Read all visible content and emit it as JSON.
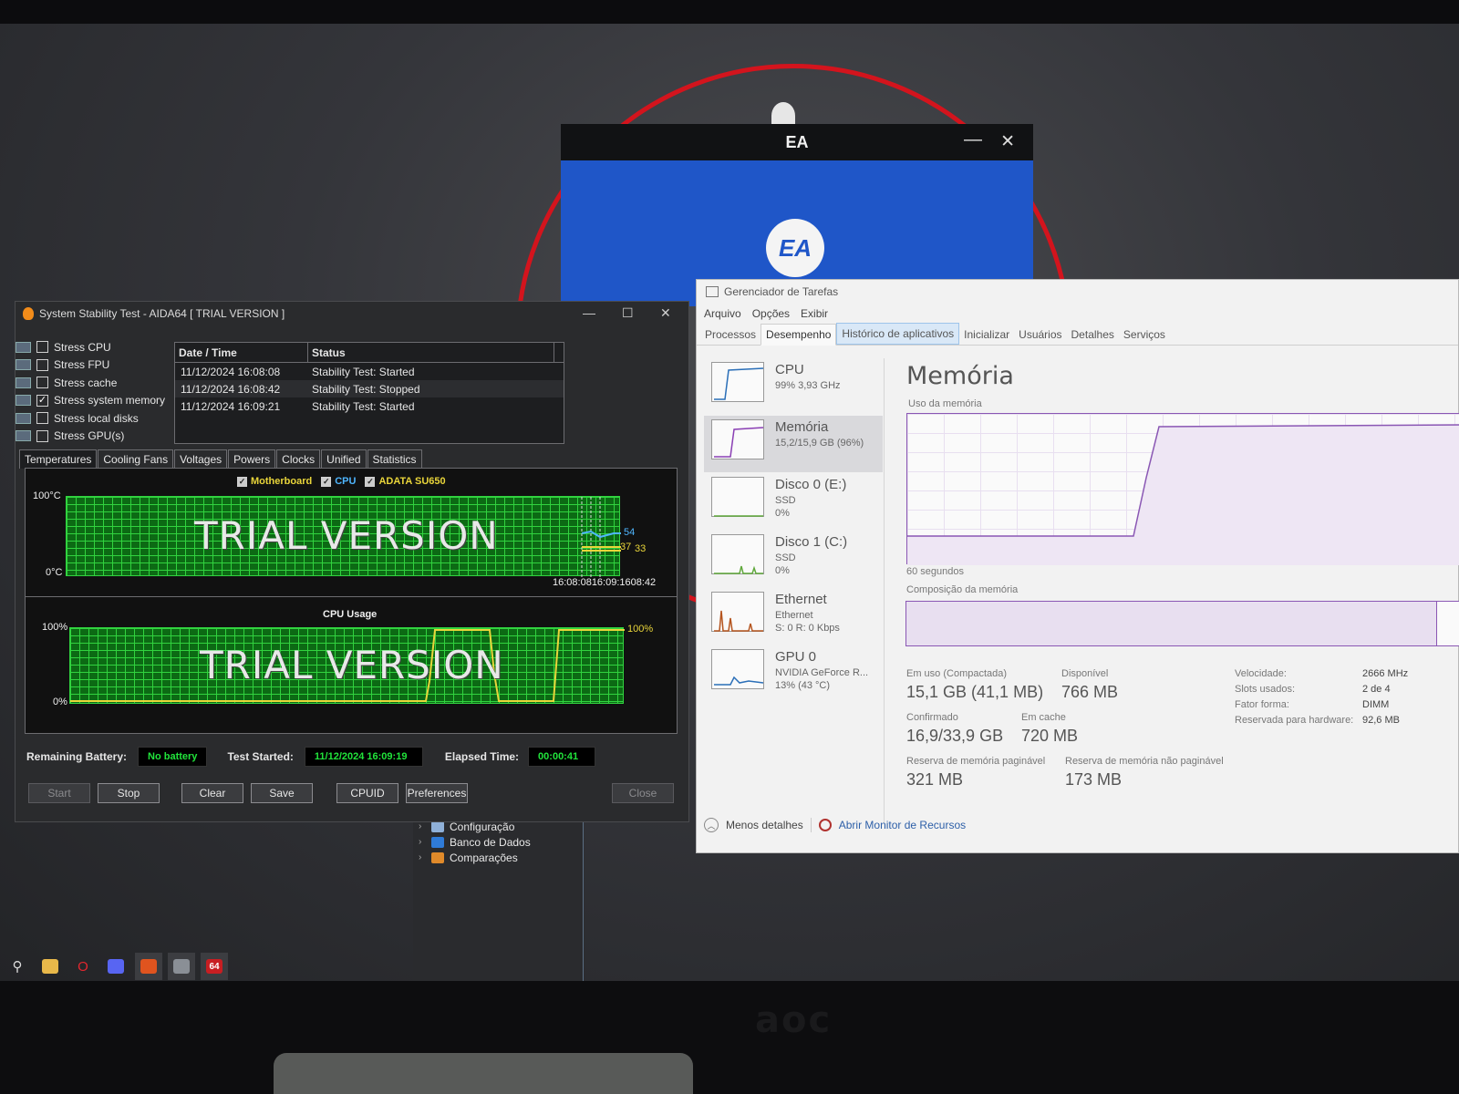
{
  "ea": {
    "title": "EA",
    "logo": "EA",
    "min_icon": "—",
    "close_icon": "✕"
  },
  "tree": {
    "items": [
      {
        "label": "Configuração",
        "color": "#8fb0d8"
      },
      {
        "label": "Banco de Dados",
        "color": "#2f7bd8"
      },
      {
        "label": "Comparações",
        "color": "#e08a2a"
      }
    ]
  },
  "taskbar": {
    "items": [
      {
        "icon": "search-icon",
        "glyph": "⚲",
        "color": ""
      },
      {
        "icon": "folder-icon",
        "glyph": "",
        "color": "#e8b84a"
      },
      {
        "icon": "opera-icon",
        "glyph": "O",
        "color": ""
      },
      {
        "icon": "discord-icon",
        "glyph": "",
        "color": "#5865f2"
      },
      {
        "icon": "ea-app-icon",
        "glyph": "",
        "color": "#e0541f"
      },
      {
        "icon": "task-manager-icon",
        "glyph": "",
        "color": "#8a8f96"
      },
      {
        "icon": "aida64-icon",
        "glyph": "64",
        "color": "#c81e22"
      }
    ]
  },
  "aida": {
    "title": "System Stability Test - AIDA64  [ TRIAL VERSION ]",
    "stress": [
      {
        "label": "Stress CPU",
        "checked": false
      },
      {
        "label": "Stress FPU",
        "checked": false
      },
      {
        "label": "Stress cache",
        "checked": false
      },
      {
        "label": "Stress system memory",
        "checked": true
      },
      {
        "label": "Stress local disks",
        "checked": false
      },
      {
        "label": "Stress GPU(s)",
        "checked": false
      }
    ],
    "log_headers": [
      "Date / Time",
      "Status"
    ],
    "log": [
      {
        "time": "11/12/2024 16:08:08",
        "status": "Stability Test: Started"
      },
      {
        "time": "11/12/2024 16:08:42",
        "status": "Stability Test: Stopped"
      },
      {
        "time": "11/12/2024 16:09:21",
        "status": "Stability Test: Started"
      }
    ],
    "tabs": [
      "Temperatures",
      "Cooling Fans",
      "Voltages",
      "Powers",
      "Clocks",
      "Unified",
      "Statistics"
    ],
    "active_tab": 0,
    "temp_legend": [
      {
        "label": "Motherboard",
        "color": "#e9d53a"
      },
      {
        "label": "CPU",
        "color": "#4fb6ff"
      },
      {
        "label": "ADATA SU650",
        "color": "#e9d53a"
      }
    ],
    "temp_max": "100°C",
    "temp_min": "0°C",
    "temp_time": "16:08:0816:09:1608:42",
    "temp_values": [
      "54",
      "37",
      "33"
    ],
    "watermark": "TRIAL VERSION",
    "cpu_title": "CPU Usage",
    "cpu_max": "100%",
    "cpu_min": "0%",
    "cpu_value": "100%",
    "battery_label": "Remaining Battery:",
    "battery_value": "No battery",
    "test_started_label": "Test Started:",
    "test_started_value": "11/12/2024 16:09:19",
    "elapsed_label": "Elapsed Time:",
    "elapsed_value": "00:00:41",
    "buttons": {
      "start": "Start",
      "stop": "Stop",
      "clear": "Clear",
      "save": "Save",
      "cpuid": "CPUID",
      "preferences": "Preferences",
      "close": "Close"
    }
  },
  "tm": {
    "title": "Gerenciador de Tarefas",
    "menu": [
      "Arquivo",
      "Opções",
      "Exibir"
    ],
    "tabs": [
      "Processos",
      "Desempenho",
      "Histórico de aplicativos",
      "Inicializar",
      "Usuários",
      "Detalhes",
      "Serviços"
    ],
    "active_tab": 1,
    "hover_tab": 2,
    "side": [
      {
        "name": "CPU",
        "l1": "99%  3,93 GHz",
        "l2": "",
        "color": "#2b6fb8"
      },
      {
        "name": "Memória",
        "l1": "15,2/15,9 GB (96%)",
        "l2": "",
        "color": "#8a3fb4"
      },
      {
        "name": "Disco 0 (E:)",
        "l1": "SSD",
        "l2": "0%",
        "color": "#5fa83b"
      },
      {
        "name": "Disco 1 (C:)",
        "l1": "SSD",
        "l2": "0%",
        "color": "#5fa83b"
      },
      {
        "name": "Ethernet",
        "l1": "Ethernet",
        "l2": "S: 0  R: 0 Kbps",
        "color": "#b5541e"
      },
      {
        "name": "GPU 0",
        "l1": "NVIDIA GeForce R...",
        "l2": "13% (43 °C)",
        "color": "#2b6fb8"
      }
    ],
    "heading": "Memória",
    "usage_label": "Uso da memória",
    "time_label": "60 segundos",
    "composition_label": "Composição da memória",
    "composition_used": 0.96,
    "stats": {
      "in_use_label": "Em uso (Compactada)",
      "in_use": "15,1 GB (41,1 MB)",
      "available_label": "Disponível",
      "available": "766 MB",
      "committed_label": "Confirmado",
      "committed": "16,9/33,9 GB",
      "cached_label": "Em cache",
      "cached": "720 MB",
      "paged_label": "Reserva de memória paginável",
      "paged": "321 MB",
      "nonpaged_label": "Reserva de memória não paginável",
      "nonpaged": "173 MB"
    },
    "specs": [
      {
        "label": "Velocidade:",
        "value": "2666 MHz"
      },
      {
        "label": "Slots usados:",
        "value": "2 de 4"
      },
      {
        "label": "Fator forma:",
        "value": "DIMM"
      },
      {
        "label": "Reservada para hardware:",
        "value": "92,6 MB"
      }
    ],
    "footer_less": "Menos detalhes",
    "footer_monitor": "Abrir Monitor de Recursos"
  }
}
